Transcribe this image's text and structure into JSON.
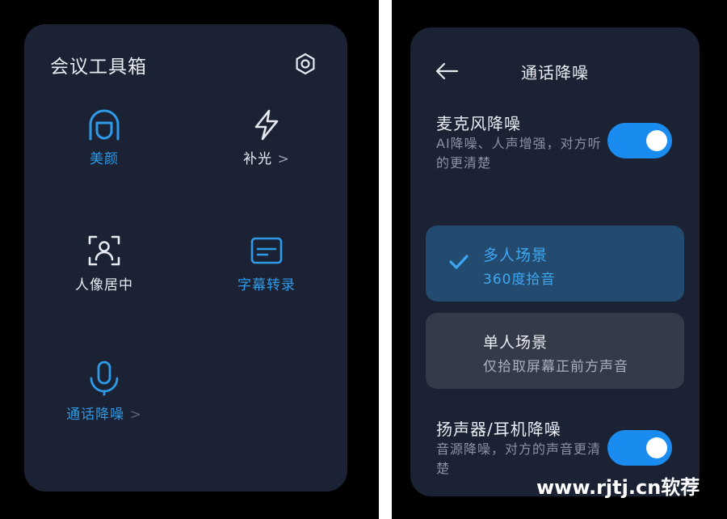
{
  "left_panel": {
    "title": "会议工具箱",
    "tools": [
      {
        "label": "美颜",
        "chevron": "",
        "icon": "face-beauty-icon",
        "state": "active"
      },
      {
        "label": "补光",
        "chevron": ">",
        "icon": "lightning-icon",
        "state": "inactive"
      },
      {
        "label": "人像居中",
        "chevron": "",
        "icon": "portrait-center-icon",
        "state": "inactive"
      },
      {
        "label": "字幕转录",
        "chevron": "",
        "icon": "subtitle-icon",
        "state": "active"
      },
      {
        "label": "通话降噪",
        "chevron": ">",
        "icon": "microphone-icon",
        "state": "active"
      }
    ]
  },
  "right_panel": {
    "title": "通话降噪",
    "mic_noise": {
      "title": "麦克风降噪",
      "desc": "AI降噪、人声增强，对方听的更清楚",
      "enabled": true
    },
    "scenes": [
      {
        "title": "多人场景",
        "desc": "360度拾音",
        "selected": true
      },
      {
        "title": "单人场景",
        "desc": "仅拾取屏幕正前方声音",
        "selected": false
      }
    ],
    "speaker_noise": {
      "title": "扬声器/耳机降噪",
      "desc": "音源降噪，对方的声音更清楚",
      "enabled": true
    }
  },
  "watermark": "www.rjtj.cn软荐",
  "colors": {
    "accent": "#1a8cf0",
    "active_text": "#2f9be8",
    "panel_bg": "#1b2233",
    "selected_scene_bg": "#234a6f",
    "unselected_scene_bg": "#343a47"
  }
}
